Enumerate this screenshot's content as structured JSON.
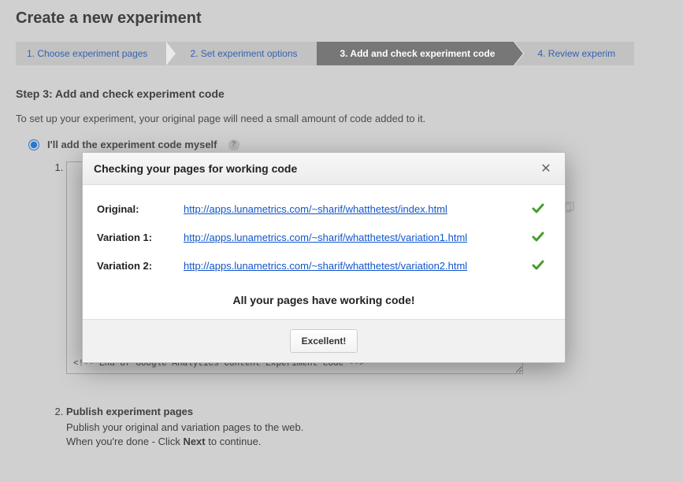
{
  "header": {
    "title": "Create a new experiment"
  },
  "wizard": {
    "steps": [
      {
        "label": "1. Choose experiment pages"
      },
      {
        "label": "2. Set experiment options"
      },
      {
        "label": "3. Add and check experiment code"
      },
      {
        "label": "4. Review experim"
      }
    ]
  },
  "section": {
    "title": "Step 3: Add and check experiment code",
    "intro": "To set up your experiment, your original page will need a small amount of code added to it.",
    "radio_label": "I'll add the experiment code myself",
    "substeps": {
      "item1_num": "1.",
      "code_bottom": "<!-- End of Google Analytics Content Experiment code -->",
      "item2_num": "2.",
      "item2_title": "Publish experiment pages",
      "item2_line1": "Publish your original and variation pages to the web.",
      "item2_line2a": "When you're done - Click ",
      "item2_line2b": "Next",
      "item2_line2c": " to continue."
    }
  },
  "modal": {
    "title": "Checking your pages for working code",
    "rows": [
      {
        "label": "Original:",
        "url": "http://apps.lunametrics.com/~sharif/whatthetest/index.html"
      },
      {
        "label": "Variation 1:",
        "url": "http://apps.lunametrics.com/~sharif/whatthetest/variation1.html"
      },
      {
        "label": "Variation 2:",
        "url": "http://apps.lunametrics.com/~sharif/whatthetest/variation2.html"
      }
    ],
    "success": "All your pages have working code!",
    "button": "Excellent!"
  }
}
